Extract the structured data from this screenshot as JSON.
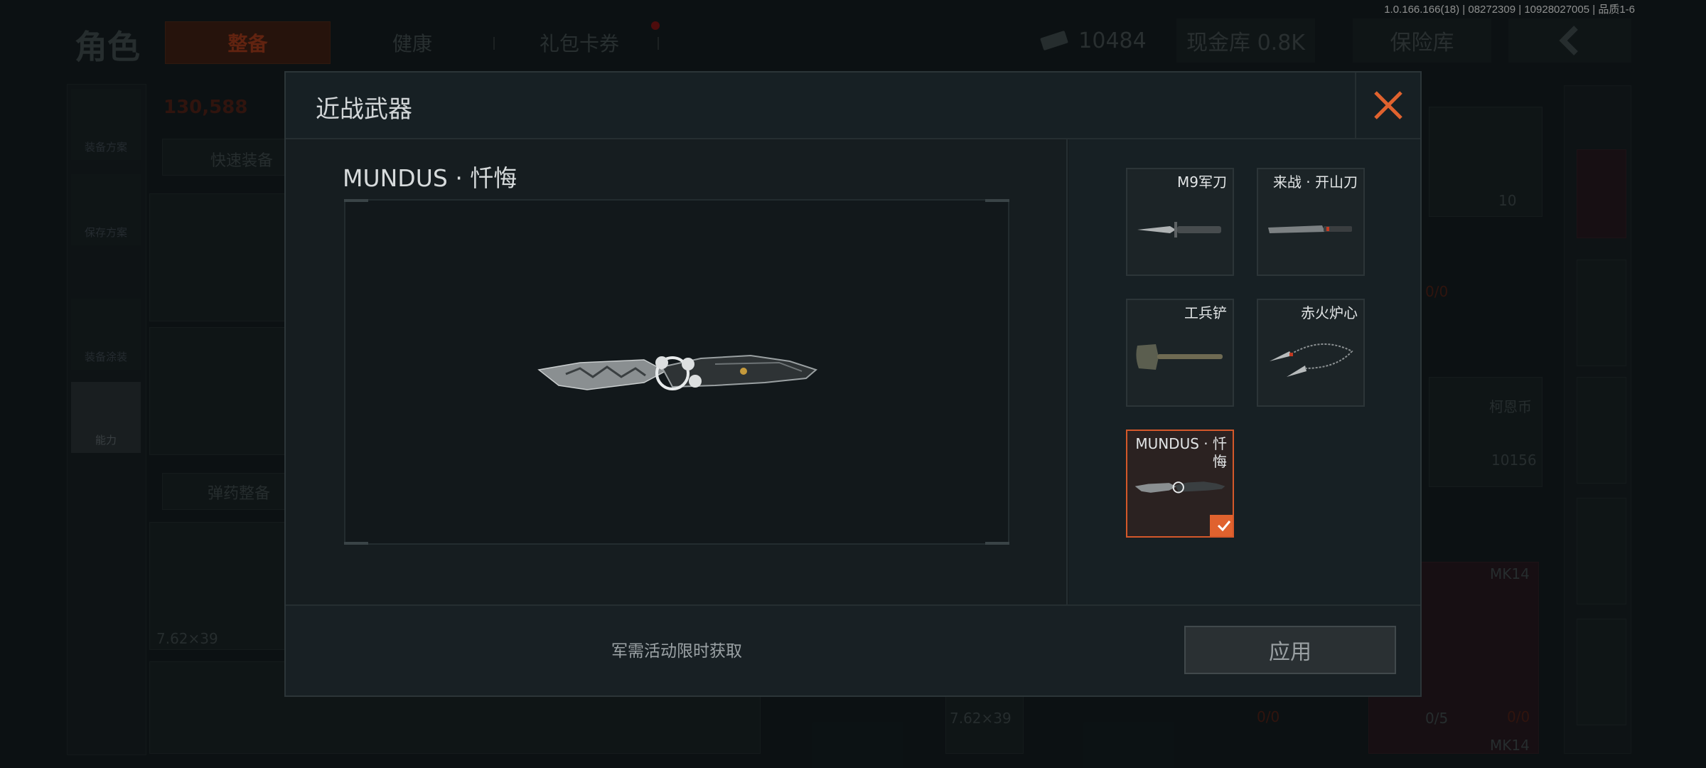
{
  "version_info": "1.0.166.166(18) | 08272309 | 10928027005 | 品质1-6",
  "background": {
    "title": "角色",
    "tabs": [
      "整备",
      "健康",
      "礼包卡券"
    ],
    "money": "10484",
    "cash_vault": "现金库 0.8K",
    "safe_box": "保险库",
    "side_buttons": [
      "装备方案",
      "保存方案",
      "装备涂装",
      "能力"
    ],
    "value": "130,588",
    "quick_equip": "快速装备",
    "ammo_equip": "弹药整备",
    "ammo_caliber": "7.62×39",
    "coin_label": "柯恩币",
    "coin_value": "10156",
    "mk14_label": "MK14",
    "counts": [
      "0/0",
      "0/0",
      "0/5",
      "0/0"
    ],
    "slot_count": "10"
  },
  "modal": {
    "title": "近战武器",
    "selected_item_name": "MUNDUS · 忏悔",
    "items": [
      {
        "name": "M9军刀",
        "icon": "bayonet-icon",
        "selected": false
      },
      {
        "name": "来战 · 开山刀",
        "icon": "machete-icon",
        "selected": false
      },
      {
        "name": "工兵铲",
        "icon": "shovel-icon",
        "selected": false
      },
      {
        "name": "赤火炉心",
        "icon": "chain-knife-icon",
        "selected": false
      },
      {
        "name": "MUNDUS · 忏悔",
        "icon": "mundus-knife-icon",
        "selected": true
      }
    ],
    "hint": "军需活动限时获取",
    "apply_label": "应用"
  },
  "colors": {
    "accent": "#e0622e",
    "panel": "#161d20"
  }
}
